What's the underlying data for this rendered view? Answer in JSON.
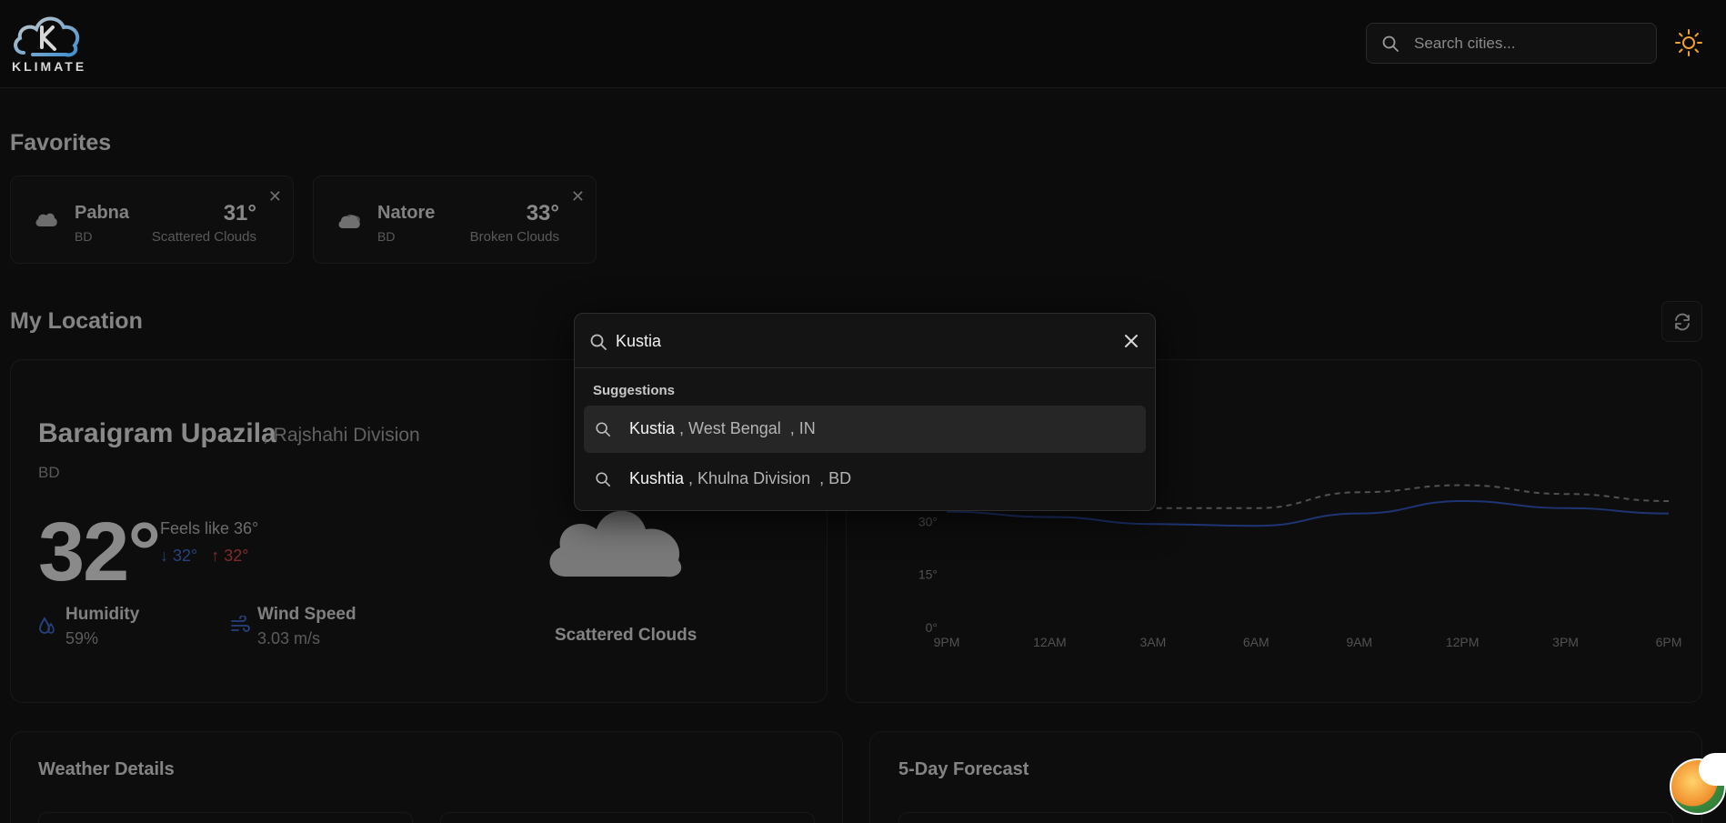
{
  "header": {
    "logo_text": "KLIMATE",
    "search_placeholder": "Search cities...",
    "theme_icon": "sun-icon"
  },
  "favorites": {
    "title": "Favorites",
    "items": [
      {
        "city": "Pabna",
        "country": "BD",
        "temp": "31°",
        "desc": "Scattered Clouds",
        "icon": "cloud-icon"
      },
      {
        "city": "Natore",
        "country": "BD",
        "temp": "33°",
        "desc": "Broken Clouds",
        "icon": "clouds-icon"
      }
    ]
  },
  "location": {
    "title": "My Location",
    "name": "Baraigram Upazila",
    "region": ", Rajshahi Division",
    "country": "BD",
    "temp": "32°",
    "feels_like": "Feels like 36°",
    "min": "32°",
    "max": "32°",
    "humidity_label": "Humidity",
    "humidity_value": "59%",
    "wind_label": "Wind Speed",
    "wind_value": "3.03 m/s",
    "condition": "Scattered Clouds"
  },
  "chart_data": {
    "type": "line",
    "x": [
      "9PM",
      "12AM",
      "3AM",
      "6AM",
      "9AM",
      "12PM",
      "3PM",
      "6PM"
    ],
    "y_ticks": [
      "0°",
      "15°",
      "30°"
    ],
    "ylim": [
      0,
      45
    ],
    "series": [
      {
        "style": "solid",
        "color": "#2f56c9",
        "values": [
          33,
          31.5,
          29.5,
          29,
          32.5,
          36,
          34,
          32.5
        ]
      },
      {
        "style": "dashed",
        "color": "#8a8a8a",
        "values": [
          37,
          35.5,
          34,
          34,
          38.5,
          40.5,
          38,
          36
        ]
      }
    ]
  },
  "sections": {
    "details_title": "Weather Details",
    "forecast_title": "5-Day Forecast"
  },
  "search_modal": {
    "query": "Kustia",
    "suggestions_label": "Suggestions",
    "suggestions": [
      {
        "name": "Kustia",
        "rest": " , West Bengal  , IN"
      },
      {
        "name": "Kushtia",
        "rest": " , Khulna Division  , BD"
      }
    ]
  },
  "colors": {
    "accent_blue": "#2f56c9",
    "max_red": "#e04646",
    "sun": "#f0a22a"
  }
}
